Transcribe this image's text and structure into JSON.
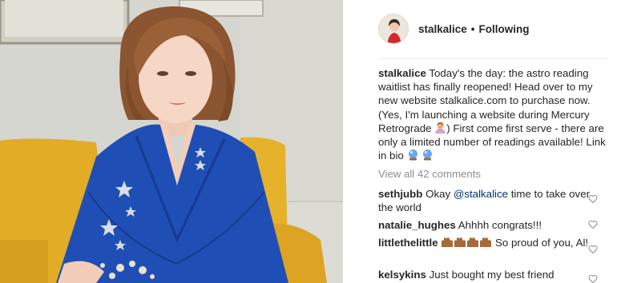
{
  "post": {
    "username": "stalkalice",
    "separator": "•",
    "follow_status": "Following"
  },
  "caption": {
    "username": "stalkalice",
    "text_part1": "Today's the day: the astro reading waitlist has finally reopened! Head over to my new website stalkalice.com to purchase now. (Yes, I'm launching a website during Mercury Retrograde",
    "text_part2": ") First come first serve - there are only a limited number of readings available! Link in bio",
    "emoji_1": "person-facepalming-emoji",
    "emoji_2": "crystal-ball-emoji"
  },
  "view_all_comments": "View all 42 comments",
  "comments": [
    {
      "username": "sethjubb",
      "pre": "Okay ",
      "mention": "@stalkalice",
      "post": " time to take over the world"
    },
    {
      "username": "natalie_hughes",
      "text": "Ahhhh congrats!!!"
    },
    {
      "username": "littlethelittle",
      "emoji": "raising-hands-emoji",
      "text": "So proud of you, Al!"
    },
    {
      "username": "kelsykins",
      "text": "Just bought my best friend"
    }
  ],
  "icons": {
    "like": "heart-outline-icon"
  },
  "colors": {
    "text": "#262626",
    "muted": "#8e8e8e",
    "mention": "#003569",
    "jacket": "#1f4fb5",
    "sofa": "#e6b22c"
  }
}
